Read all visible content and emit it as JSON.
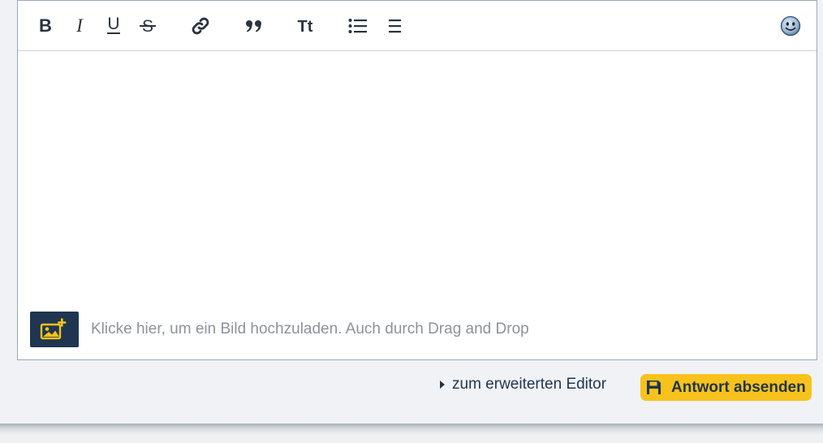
{
  "toolbar": {
    "buttons": [
      {
        "name": "bold-icon",
        "glyph": "B"
      },
      {
        "name": "italic-icon",
        "glyph": "I"
      },
      {
        "name": "underline-icon",
        "glyph": "U"
      },
      {
        "name": "strikethrough-icon",
        "glyph": "S"
      },
      {
        "name": "link-icon"
      },
      {
        "name": "quote-icon"
      },
      {
        "name": "text-size-icon",
        "glyph": "Tt"
      },
      {
        "name": "bullet-list-icon"
      },
      {
        "name": "numbered-list-icon",
        "glyph": "123"
      },
      {
        "name": "emoji-icon"
      }
    ]
  },
  "editor": {
    "content": ""
  },
  "upload": {
    "icon": "image-upload-icon",
    "text": "Klicke hier, um ein Bild hochzuladen. Auch durch Drag and Drop"
  },
  "footer": {
    "advanced_link": "zum erweiterten Editor",
    "submit_icon": "save-icon",
    "submit_label": "Antwort absenden"
  },
  "colors": {
    "accent": "#f8c21c",
    "navy": "#1f3550",
    "placeholder": "#8d939a",
    "background": "#f0f2f5"
  }
}
